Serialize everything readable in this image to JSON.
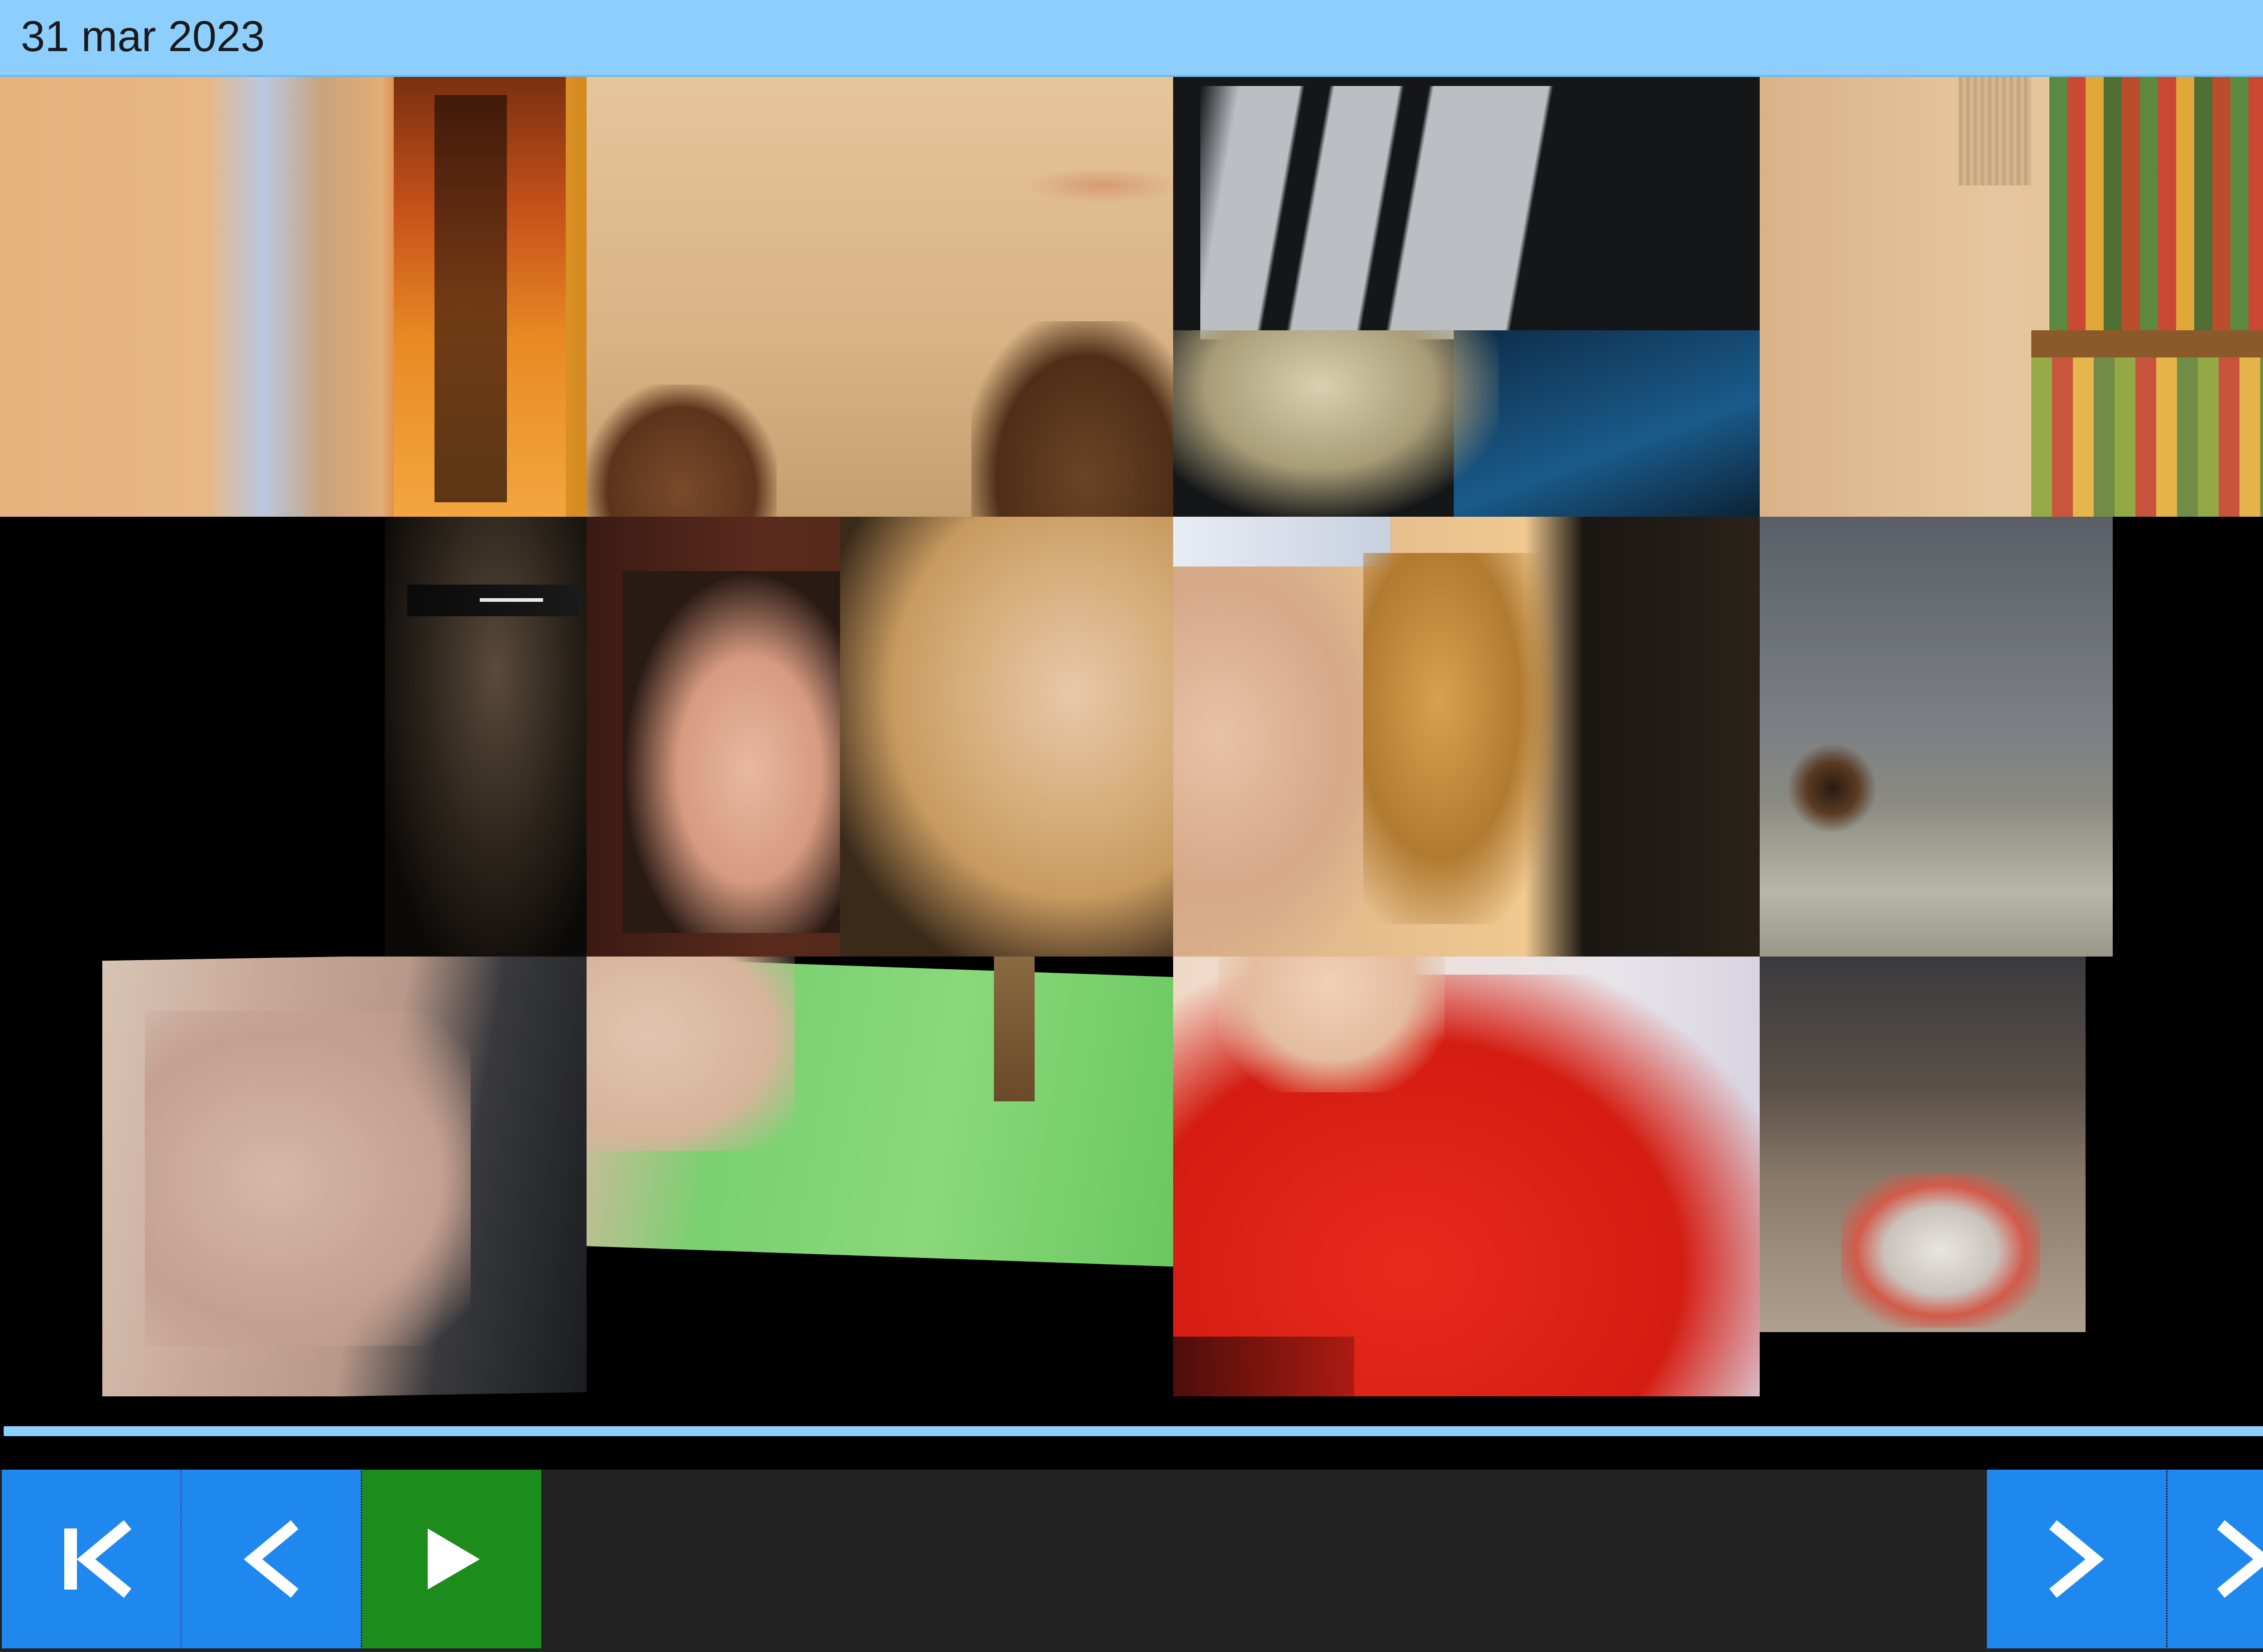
{
  "header": {
    "date": "31 mar 2023",
    "settings_icon": "gear-icon",
    "background_color": "#8ccfff"
  },
  "mosaic": {
    "tiles": [
      {
        "name": "photo-tile-poster",
        "description_icon": "photo"
      },
      {
        "name": "photo-tile-wall"
      },
      {
        "name": "photo-tile-flag"
      },
      {
        "name": "photo-tile-shelf"
      },
      {
        "name": "photo-tile-sunglasses"
      },
      {
        "name": "photo-tile-selfie-couple"
      },
      {
        "name": "photo-tile-face"
      },
      {
        "name": "photo-tile-cat"
      },
      {
        "name": "photo-tile-arm"
      },
      {
        "name": "photo-tile-green-shirt"
      },
      {
        "name": "photo-tile-red-shirt"
      },
      {
        "name": "photo-tile-bag"
      }
    ]
  },
  "progress": {
    "fraction": 1.0,
    "color": "#8ccfff"
  },
  "controls": {
    "first_icon": "skip-to-start-icon",
    "prev_icon": "chevron-left-icon",
    "play_icon": "play-icon",
    "next_icon": "chevron-right-icon",
    "last_icon": "skip-to-end-icon",
    "button_color": "#1e88ee",
    "play_color": "#1c8c1c"
  }
}
